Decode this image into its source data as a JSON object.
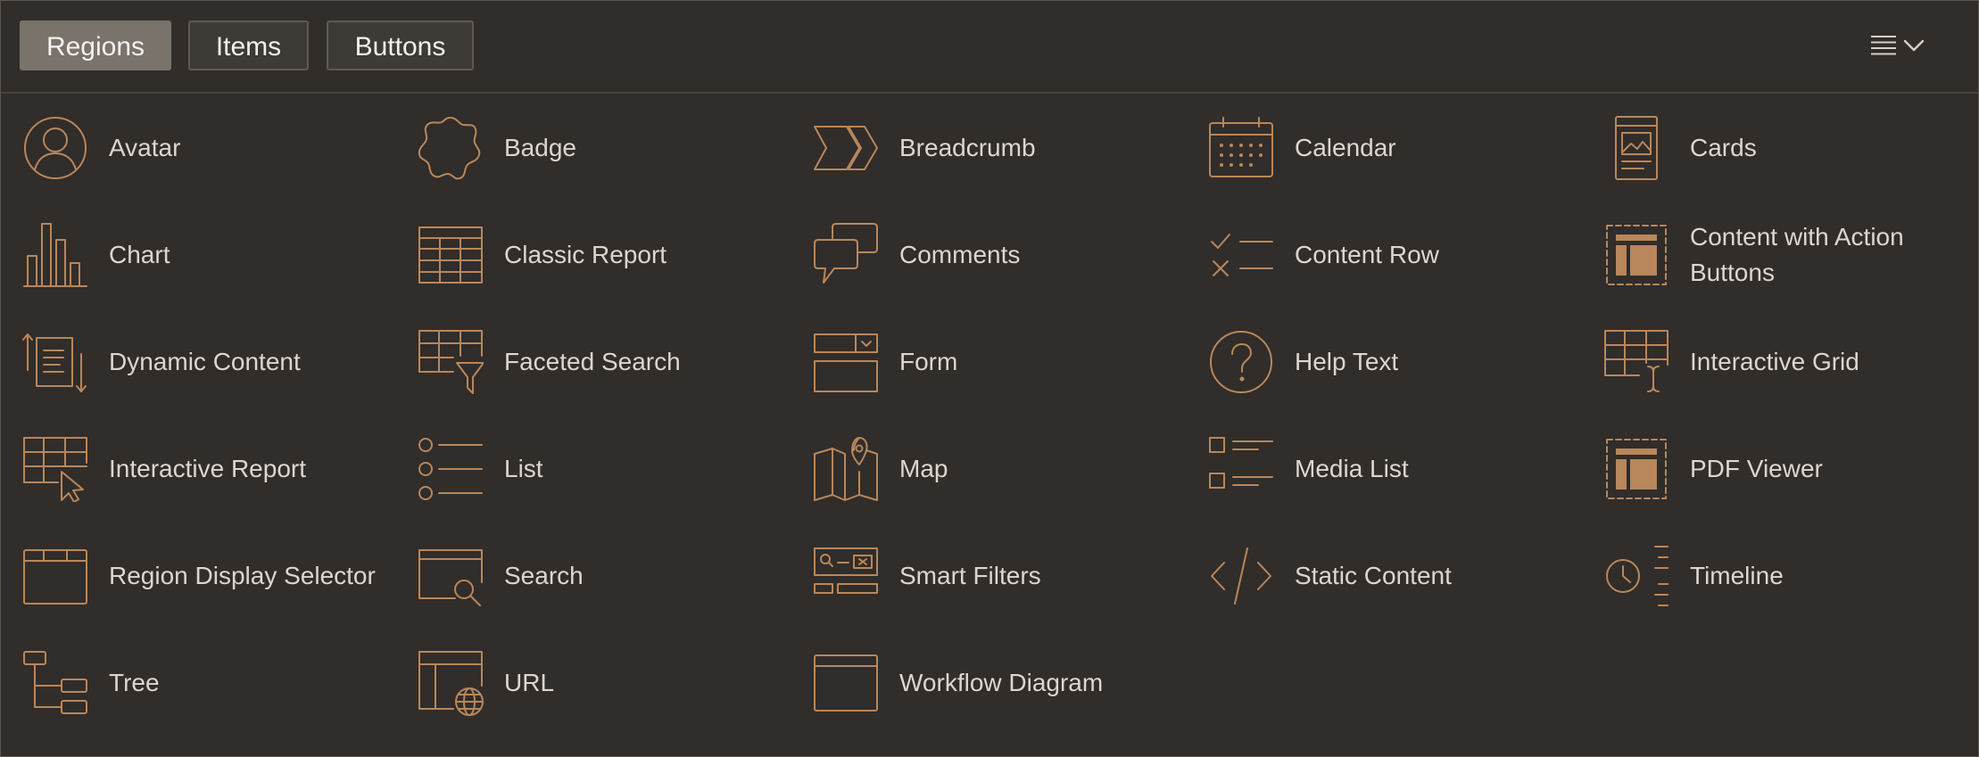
{
  "tabs": [
    {
      "label": "Regions",
      "active": true
    },
    {
      "label": "Items",
      "active": false
    },
    {
      "label": "Buttons",
      "active": false
    }
  ],
  "view_menu": {
    "icon": "list-view-icon",
    "caret": "chevron-down-icon"
  },
  "colors": {
    "background": "#312d2a",
    "icon_accent": "#b8875c",
    "label_text": "#ddd6cf",
    "active_tab": "#79736c"
  },
  "regions": [
    {
      "label": "Avatar",
      "icon": "avatar-icon"
    },
    {
      "label": "Badge",
      "icon": "badge-icon"
    },
    {
      "label": "Breadcrumb",
      "icon": "breadcrumb-icon"
    },
    {
      "label": "Calendar",
      "icon": "calendar-icon"
    },
    {
      "label": "Cards",
      "icon": "cards-icon"
    },
    {
      "label": "Chart",
      "icon": "chart-icon"
    },
    {
      "label": "Classic Report",
      "icon": "classic-report-icon"
    },
    {
      "label": "Comments",
      "icon": "comments-icon"
    },
    {
      "label": "Content Row",
      "icon": "content-row-icon"
    },
    {
      "label": "Content with Action Buttons",
      "icon": "content-action-buttons-icon"
    },
    {
      "label": "Dynamic Content",
      "icon": "dynamic-content-icon"
    },
    {
      "label": "Faceted Search",
      "icon": "faceted-search-icon"
    },
    {
      "label": "Form",
      "icon": "form-icon"
    },
    {
      "label": "Help Text",
      "icon": "help-text-icon"
    },
    {
      "label": "Interactive Grid",
      "icon": "interactive-grid-icon"
    },
    {
      "label": "Interactive Report",
      "icon": "interactive-report-icon"
    },
    {
      "label": "List",
      "icon": "list-icon"
    },
    {
      "label": "Map",
      "icon": "map-icon"
    },
    {
      "label": "Media List",
      "icon": "media-list-icon"
    },
    {
      "label": "PDF Viewer",
      "icon": "pdf-viewer-icon"
    },
    {
      "label": "Region Display Selector",
      "icon": "region-display-selector-icon"
    },
    {
      "label": "Search",
      "icon": "search-icon"
    },
    {
      "label": "Smart Filters",
      "icon": "smart-filters-icon"
    },
    {
      "label": "Static Content",
      "icon": "static-content-icon"
    },
    {
      "label": "Timeline",
      "icon": "timeline-icon"
    },
    {
      "label": "Tree",
      "icon": "tree-icon"
    },
    {
      "label": "URL",
      "icon": "url-icon"
    },
    {
      "label": "Workflow Diagram",
      "icon": "workflow-diagram-icon"
    }
  ]
}
